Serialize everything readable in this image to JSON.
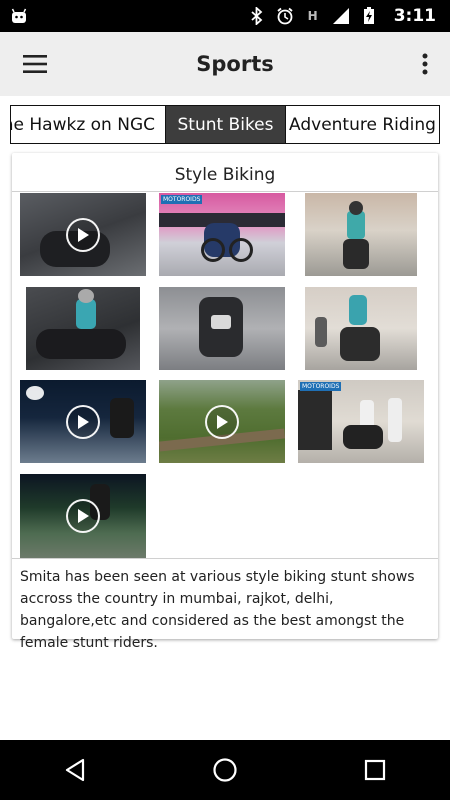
{
  "status_bar": {
    "time": "3:11",
    "icons": [
      "android-icon",
      "bluetooth-icon",
      "alarm-icon",
      "h-network-icon",
      "signal-icon",
      "battery-charging-icon"
    ],
    "network_letter": "H"
  },
  "app_bar": {
    "title": "Sports",
    "menu_icon": "hamburger-menu-icon",
    "overflow_icon": "more-vert-icon"
  },
  "tabs": [
    {
      "label": "he Hawkz on NGC",
      "selected": false
    },
    {
      "label": "Stunt Bikes",
      "selected": true
    },
    {
      "label": "Adventure Riding",
      "selected": false
    }
  ],
  "card": {
    "title": "Style Biking",
    "description": "Smita has been seen at various style biking stunt shows accross the country in mumbai, rajkot, delhi, bangalore,etc and considered as the best amongst the female stunt riders.",
    "thumbnails": [
      {
        "type": "video"
      },
      {
        "type": "image",
        "watermark": "MOTOROIDS"
      },
      {
        "type": "image"
      },
      {
        "type": "image"
      },
      {
        "type": "image"
      },
      {
        "type": "image"
      },
      {
        "type": "video"
      },
      {
        "type": "video"
      },
      {
        "type": "image",
        "watermark": "MOTOROIDS"
      },
      {
        "type": "video"
      }
    ]
  },
  "nav_bar": {
    "icons": [
      "back-icon",
      "home-icon",
      "recents-icon"
    ]
  },
  "colors": {
    "app_bar_bg": "#eeeeee",
    "selected_tab_bg": "#3d3d3d",
    "status_bar_bg": "#000000"
  }
}
